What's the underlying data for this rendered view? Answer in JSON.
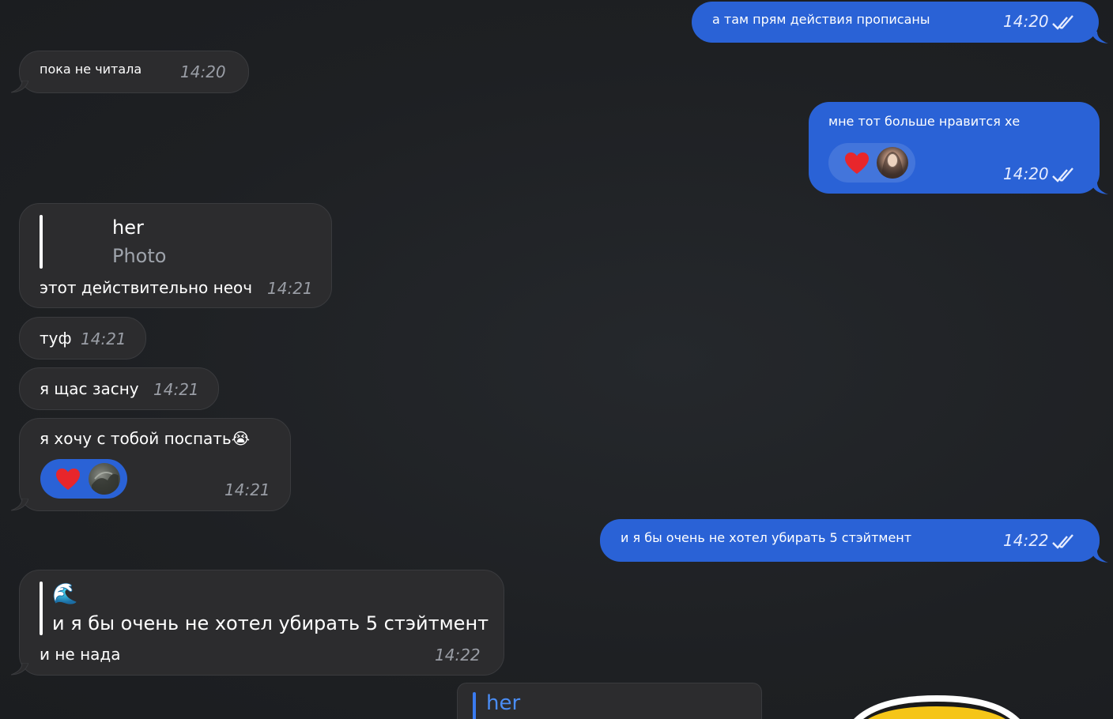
{
  "messages": {
    "m1": {
      "text": "а там прям действия прописаны",
      "time": "14:20"
    },
    "m2": {
      "text": "пока не читала",
      "time": "14:20"
    },
    "m3": {
      "text": "мне тот больше нравится хе",
      "time": "14:20",
      "reaction": "heart"
    },
    "m4": {
      "reply_name": "her",
      "reply_sub": "Photo",
      "text": "этот действительно неоч",
      "time": "14:21"
    },
    "m5": {
      "text": "туф",
      "time": "14:21"
    },
    "m6": {
      "text": "я щас засну",
      "time": "14:21"
    },
    "m7": {
      "text": "я хочу с тобой поспать😭",
      "time": "14:21",
      "reaction": "heart"
    },
    "m8": {
      "text": "и я бы очень не хотел убирать 5 стэйтмент",
      "time": "14:22"
    },
    "m9": {
      "reply_emoji": "🌊",
      "reply_text": "и я бы очень не хотел убирать 5 стэйтмент",
      "text": "и не нада",
      "time": "14:22"
    },
    "m10": {
      "reply_name": "her"
    }
  },
  "colors": {
    "outgoing": "#2a62d6",
    "incoming": "#2c2c2e",
    "background": "#1f2124"
  }
}
